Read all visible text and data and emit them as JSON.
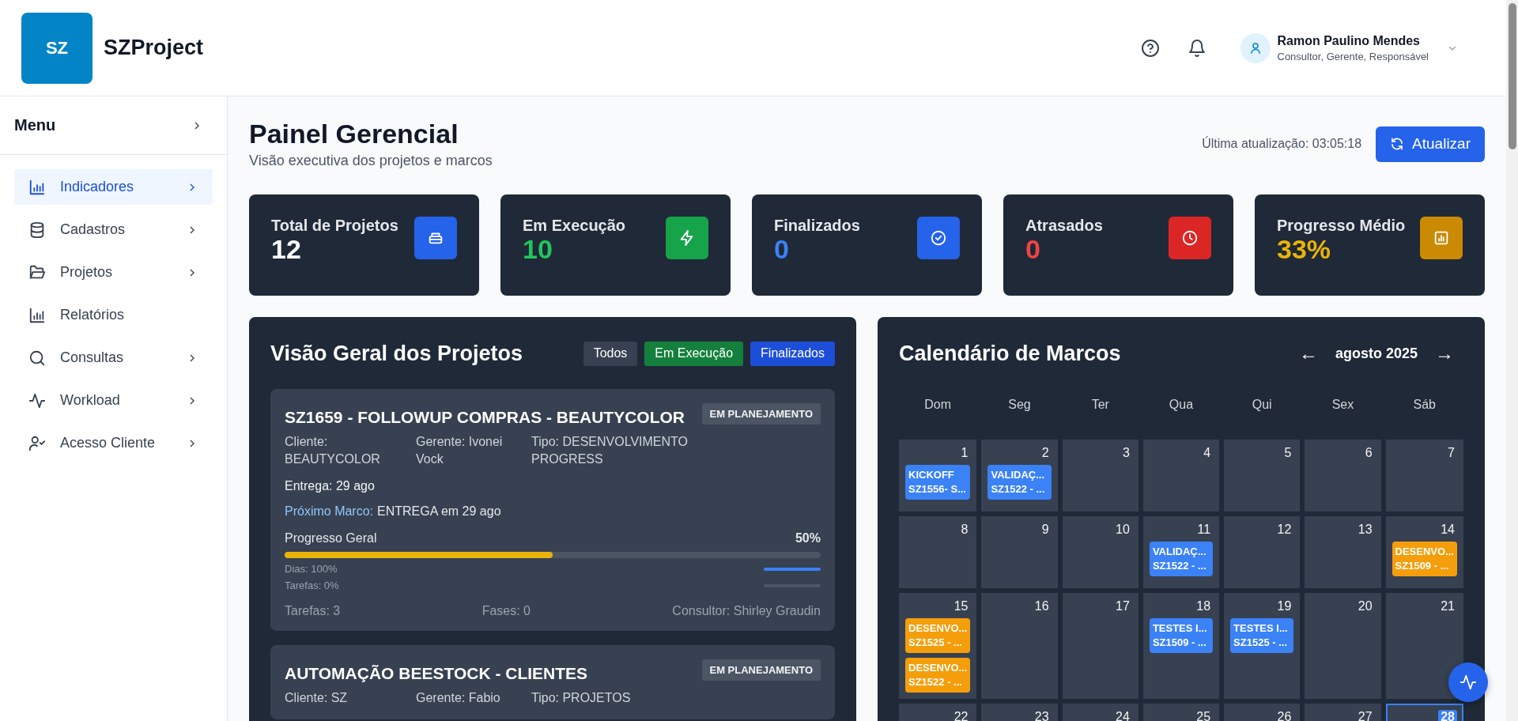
{
  "header": {
    "logo": "SZ",
    "app_name": "SZProject",
    "user": {
      "name": "Ramon Paulino Mendes",
      "roles": "Consultor, Gerente, Responsável"
    }
  },
  "sidebar": {
    "title": "Menu",
    "items": [
      {
        "label": "Indicadores",
        "selected": true,
        "submenu": true
      },
      {
        "label": "Cadastros",
        "selected": false,
        "submenu": true
      },
      {
        "label": "Projetos",
        "selected": false,
        "submenu": true
      },
      {
        "label": "Relatórios",
        "selected": false,
        "submenu": false
      },
      {
        "label": "Consultas",
        "selected": false,
        "submenu": true
      },
      {
        "label": "Workload",
        "selected": false,
        "submenu": true
      },
      {
        "label": "Acesso Cliente",
        "selected": false,
        "submenu": true
      }
    ]
  },
  "page": {
    "title": "Painel Gerencial",
    "subtitle": "Visão executiva dos projetos e marcos",
    "last_update": "Última atualização: 03:05:18",
    "refresh_button": "Atualizar"
  },
  "stats": [
    {
      "kind": "total",
      "label": "Total de Projetos",
      "value": "12"
    },
    {
      "kind": "running",
      "label": "Em Execução",
      "value": "10"
    },
    {
      "kind": "done",
      "label": "Finalizados",
      "value": "0"
    },
    {
      "kind": "late",
      "label": "Atrasados",
      "value": "0"
    },
    {
      "kind": "progress",
      "label": "Progresso Médio",
      "value": "33%"
    }
  ],
  "projects_panel": {
    "title": "Visão Geral dos Projetos",
    "filters": [
      {
        "label": "Todos",
        "color": "#374151"
      },
      {
        "label": "Em Execução",
        "color": "#15803d"
      },
      {
        "label": "Finalizados",
        "color": "#1d4ed8"
      }
    ],
    "projects": [
      {
        "title": "SZ1659 - FOLLOWUP COMPRAS - BEAUTYCOLOR",
        "status": "EM PLANEJAMENTO",
        "client": "Cliente: BEAUTYCOLOR",
        "manager": "Gerente: Ivonei Vock",
        "type": "Tipo: DESENVOLVIMENTO PROGRESS",
        "delivery": "Entrega: 29 ago",
        "milestone_label": "Próximo Marco:",
        "milestone": "ENTREGA em 29 ago",
        "progress_label": "Progresso Geral",
        "progress_value": "50%",
        "level": 0.5,
        "sub_bars": [
          {
            "label": "Dias: 100%",
            "level": 1
          },
          {
            "label": "Tarefas: 0%",
            "level": 0
          }
        ],
        "tasks": "Tarefas: 3",
        "phases": "Fases: 0",
        "consultant": "Consultor: Shirley Graudin"
      },
      {
        "title": "AUTOMAÇÃO BEESTOCK - CLIENTES",
        "status": "EM PLANEJAMENTO",
        "client": "Cliente: SZ",
        "manager": "Gerente: Fabio",
        "type": "Tipo: PROJETOS"
      }
    ]
  },
  "calendar": {
    "title": "Calendário de Marcos",
    "prev": "←",
    "month": "agosto 2025",
    "next": "→",
    "weekdays": [
      "Dom",
      "Seg",
      "Ter",
      "Qua",
      "Qui",
      "Sex",
      "Sáb"
    ],
    "weeks": [
      [
        {
          "day": "1",
          "events": [
            {
              "title": "KICKOFF",
              "project": "SZ1556- S...",
              "color": "#3b82f6"
            }
          ]
        },
        {
          "day": "2",
          "events": [
            {
              "title": "VALIDAÇ...",
              "project": "SZ1522 - ...",
              "color": "#3b82f6"
            }
          ]
        },
        {
          "day": "3"
        },
        {
          "day": "4"
        },
        {
          "day": "5"
        },
        {
          "day": "6"
        },
        {
          "day": "7"
        }
      ],
      [
        {
          "day": "8"
        },
        {
          "day": "9"
        },
        {
          "day": "10"
        },
        {
          "day": "11",
          "events": [
            {
              "title": "VALIDAÇ...",
              "project": "SZ1522 - ...",
              "color": "#3b82f6"
            }
          ]
        },
        {
          "day": "12"
        },
        {
          "day": "13"
        },
        {
          "day": "14",
          "events": [
            {
              "title": "DESENVO...",
              "project": "SZ1509 - ...",
              "color": "#f59e0b"
            }
          ]
        }
      ],
      [
        {
          "day": "15",
          "events": [
            {
              "title": "DESENVO...",
              "project": "SZ1525 - ...",
              "color": "#f59e0b"
            },
            {
              "title": "DESENVO...",
              "project": "SZ1522 - ...",
              "color": "#f59e0b"
            }
          ]
        },
        {
          "day": "16"
        },
        {
          "day": "17"
        },
        {
          "day": "18",
          "events": [
            {
              "title": "TESTES I...",
              "project": "SZ1509 - ...",
              "color": "#3b82f6"
            }
          ]
        },
        {
          "day": "19",
          "events": [
            {
              "title": "TESTES I...",
              "project": "SZ1525 - ...",
              "color": "#3b82f6"
            }
          ]
        },
        {
          "day": "20"
        },
        {
          "day": "21"
        }
      ],
      [
        {
          "day": "22"
        },
        {
          "day": "23"
        },
        {
          "day": "24"
        },
        {
          "day": "25"
        },
        {
          "day": "26"
        },
        {
          "day": "27"
        },
        {
          "day": "28",
          "today": true
        }
      ]
    ]
  }
}
